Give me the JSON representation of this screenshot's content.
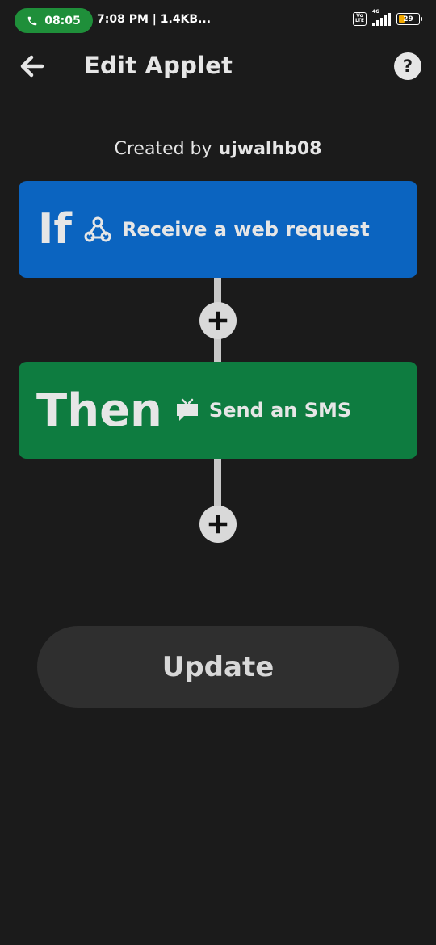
{
  "status_bar": {
    "call_time": "08:05",
    "info_text": "7:08 PM | 1.4KB...",
    "network_label": "4G",
    "volte_label": "Vo LTE",
    "battery_level": "29",
    "call_pill_color": "#1f8f3a"
  },
  "header": {
    "title": "Edit Applet",
    "help_label": "?",
    "back_icon": "back-arrow-icon"
  },
  "created_by": {
    "label": "Created by",
    "username": "ujwalhb08"
  },
  "if_block": {
    "keyword": "If",
    "service_icon": "webhooks-icon",
    "label": "Receive a web request",
    "color": "#0b64c0"
  },
  "then_block": {
    "keyword": "Then",
    "service_icon": "sms-icon",
    "label": "Send an SMS",
    "color": "#0e7c40"
  },
  "update_button": {
    "label": "Update"
  }
}
